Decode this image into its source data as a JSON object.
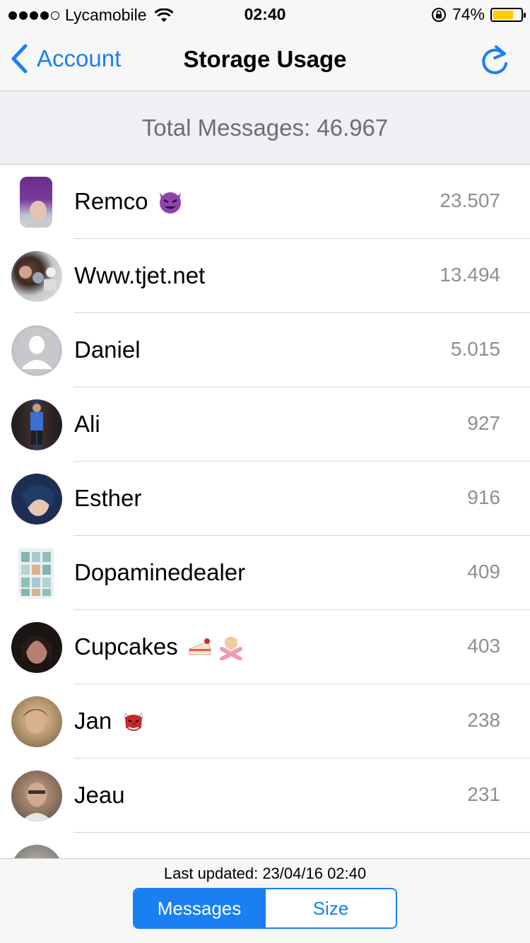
{
  "status_bar": {
    "carrier": "Lycamobile",
    "time": "02:40",
    "battery_percent": "74%",
    "battery_level": 0.74,
    "battery_color": "#ffcc00",
    "signal_icon": "signal-dots-icon",
    "wifi_icon": "wifi-icon",
    "lock_icon": "rotation-lock-icon"
  },
  "nav": {
    "back_label": "Account",
    "title": "Storage Usage",
    "refresh_icon": "refresh-icon",
    "accent_color": "#1a7ff3"
  },
  "summary": {
    "total_text": "Total Messages: 46.967"
  },
  "contacts": [
    {
      "name": "Remco",
      "emoji": "smiling-devil-emoji",
      "count": "23.507"
    },
    {
      "name": "Www.tjet.net",
      "emoji": "",
      "count": "13.494"
    },
    {
      "name": "Daniel",
      "emoji": "",
      "count": "5.015"
    },
    {
      "name": "Ali",
      "emoji": "",
      "count": "927"
    },
    {
      "name": "Esther",
      "emoji": "",
      "count": "916"
    },
    {
      "name": "Dopaminedealer",
      "emoji": "",
      "count": "409"
    },
    {
      "name": "Cupcakes",
      "emoji": "cake-and-no-gesture-emoji",
      "count": "403"
    },
    {
      "name": "Jan",
      "emoji": "goblin-mask-emoji",
      "count": "238"
    },
    {
      "name": "Jeau",
      "emoji": "",
      "count": "231"
    }
  ],
  "footer": {
    "last_updated": "Last updated: 23/04/16 02:40",
    "segments": [
      "Messages",
      "Size"
    ],
    "selected_segment": "Messages"
  }
}
